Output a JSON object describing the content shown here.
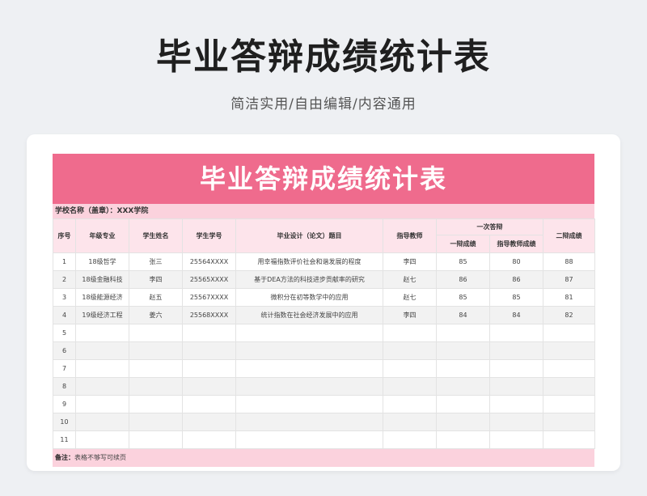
{
  "page": {
    "title": "毕业答辩成绩统计表",
    "subtitle": "简洁实用/自由编辑/内容通用"
  },
  "sheet": {
    "banner": "毕业答辩成绩统计表",
    "school_label": "学校名称（盖章）：XXX学院",
    "headers": {
      "seq": "序号",
      "major": "年级专业",
      "name": "学生姓名",
      "id": "学生学号",
      "topic": "毕业设计（论文）题目",
      "advisor": "指导教师",
      "first_group": "一次答辩",
      "first_score": "一辩成绩",
      "advisor_score": "指导教师成绩",
      "second_score": "二辩成绩"
    },
    "rows": [
      {
        "seq": "1",
        "major": "18级哲学",
        "name": "张三",
        "id": "25564XXXX",
        "topic": "用幸福指数评价社会和谐发展的程度",
        "advisor": "李四",
        "first": "85",
        "advisor_score": "80",
        "second": "88"
      },
      {
        "seq": "2",
        "major": "18级金融科技",
        "name": "李四",
        "id": "25565XXXX",
        "topic": "基于DEA方法的科技进步贡献率的研究",
        "advisor": "赵七",
        "first": "86",
        "advisor_score": "86",
        "second": "87"
      },
      {
        "seq": "3",
        "major": "18级能源经济",
        "name": "赵五",
        "id": "25567XXXX",
        "topic": "微积分在初等数学中的应用",
        "advisor": "赵七",
        "first": "85",
        "advisor_score": "85",
        "second": "81"
      },
      {
        "seq": "4",
        "major": "19级经济工程",
        "name": "姜六",
        "id": "25568XXXX",
        "topic": "统计指数在社会经济发展中的应用",
        "advisor": "李四",
        "first": "84",
        "advisor_score": "84",
        "second": "82"
      },
      {
        "seq": "5",
        "major": "",
        "name": "",
        "id": "",
        "topic": "",
        "advisor": "",
        "first": "",
        "advisor_score": "",
        "second": ""
      },
      {
        "seq": "6",
        "major": "",
        "name": "",
        "id": "",
        "topic": "",
        "advisor": "",
        "first": "",
        "advisor_score": "",
        "second": ""
      },
      {
        "seq": "7",
        "major": "",
        "name": "",
        "id": "",
        "topic": "",
        "advisor": "",
        "first": "",
        "advisor_score": "",
        "second": ""
      },
      {
        "seq": "8",
        "major": "",
        "name": "",
        "id": "",
        "topic": "",
        "advisor": "",
        "first": "",
        "advisor_score": "",
        "second": ""
      },
      {
        "seq": "9",
        "major": "",
        "name": "",
        "id": "",
        "topic": "",
        "advisor": "",
        "first": "",
        "advisor_score": "",
        "second": ""
      },
      {
        "seq": "10",
        "major": "",
        "name": "",
        "id": "",
        "topic": "",
        "advisor": "",
        "first": "",
        "advisor_score": "",
        "second": ""
      },
      {
        "seq": "11",
        "major": "",
        "name": "",
        "id": "",
        "topic": "",
        "advisor": "",
        "first": "",
        "advisor_score": "",
        "second": ""
      }
    ],
    "note_label": "备注：",
    "note_text": "表格不够写可续页"
  }
}
